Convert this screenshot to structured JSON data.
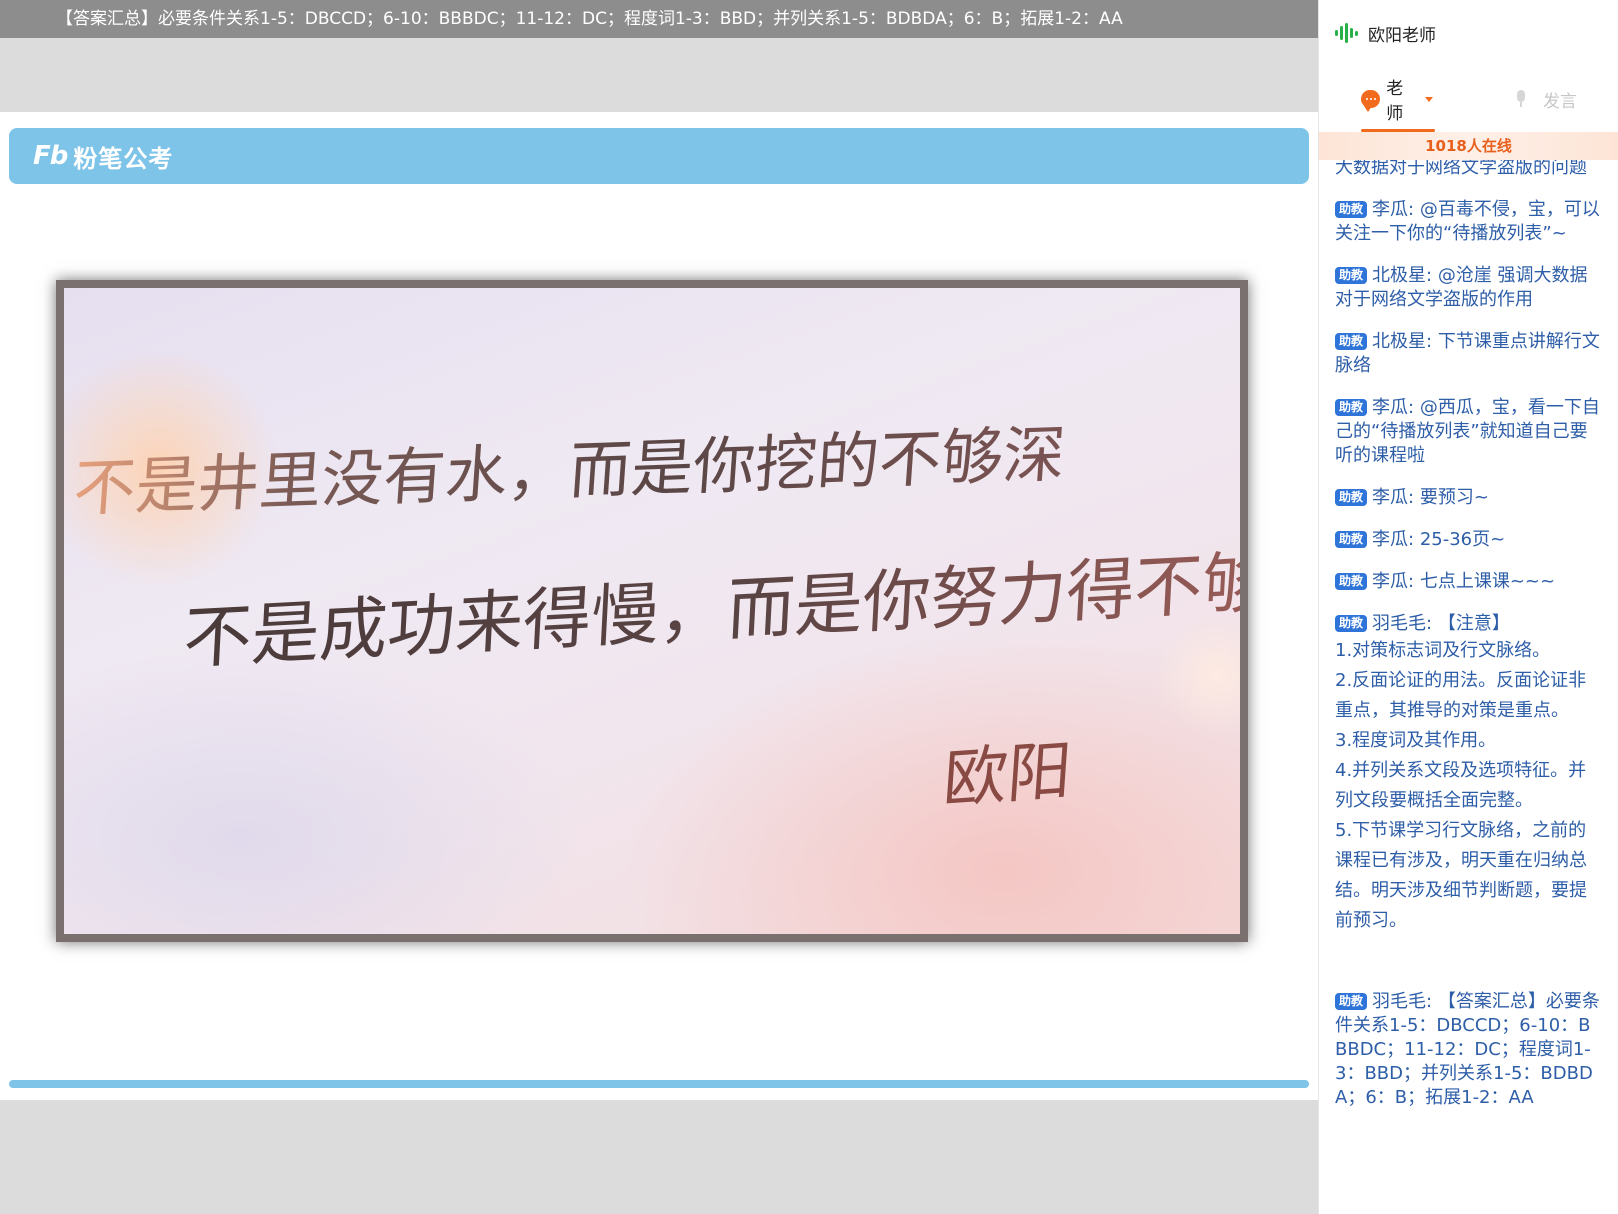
{
  "marquee_text": "【答案汇总】必要条件关系1-5：DBCCD；6-10：BBBDC；11-12：DC；程度词1-3：BBD；并列关系1-5：BDBDA；6：B；拓展1-2：AA",
  "slide": {
    "logo_mark": "Fb",
    "logo_text": "粉笔公考",
    "handwriting": {
      "line1": "不是井里没有水，而是你挖的不够深",
      "line2": "不是成功来得慢，而是你努力得不够狠",
      "signature": "欧阳"
    }
  },
  "side": {
    "teacher_name": "欧阳老师",
    "tab_teacher": "老师",
    "tab_speak": "发言",
    "online_count": "1018人在线",
    "badge": "助教",
    "messages": [
      {
        "text": "大数据对于网络文学盗版的问题"
      },
      {
        "author": "李瓜:",
        "text": "@百毒不侵，宝，可以关注一下你的“待播放列表”~"
      },
      {
        "author": "北极星:",
        "text": "@沧崖 强调大数据对于网络文学盗版的作用"
      },
      {
        "author": "北极星:",
        "text": "下节课重点讲解行文脉络"
      },
      {
        "author": "李瓜:",
        "text": "@西瓜，宝，看一下自己的“待播放列表”就知道自己要听的课程啦"
      },
      {
        "author": "李瓜:",
        "text": "要预习~"
      },
      {
        "author": "李瓜:",
        "text": "25-36页~"
      },
      {
        "author": "李瓜:",
        "text": "七点上课课~~~"
      },
      {
        "author": "羽毛毛:",
        "text": "【注意】"
      }
    ],
    "notice_lines": [
      "1.对策标志词及行文脉络。",
      "2.反面论证的用法。反面论证非重点，其推导的对策是重点。",
      "3.程度词及其作用。",
      "4.并列关系文段及选项特征。并列文段要概括全面完整。",
      "5.下节课学习行文脉络，之前的课程已有涉及，明天重在归纳总结。明天涉及细节判断题，要提前预习。"
    ],
    "last_message": {
      "author": "羽毛毛:",
      "text": "【答案汇总】必要条件关系1-5：DBCCD；6-10：BBBDC；11-12：DC；程度词1-3：BBD；并列关系1-5：BDBDA；6：B；拓展1-2：AA"
    }
  },
  "colors": {
    "accent_orange": "#f26a1b",
    "header_blue": "#7ec3e8",
    "chat_blue": "#2e5ea8",
    "badge_blue": "#2e74d9",
    "voice_green": "#27b148"
  }
}
